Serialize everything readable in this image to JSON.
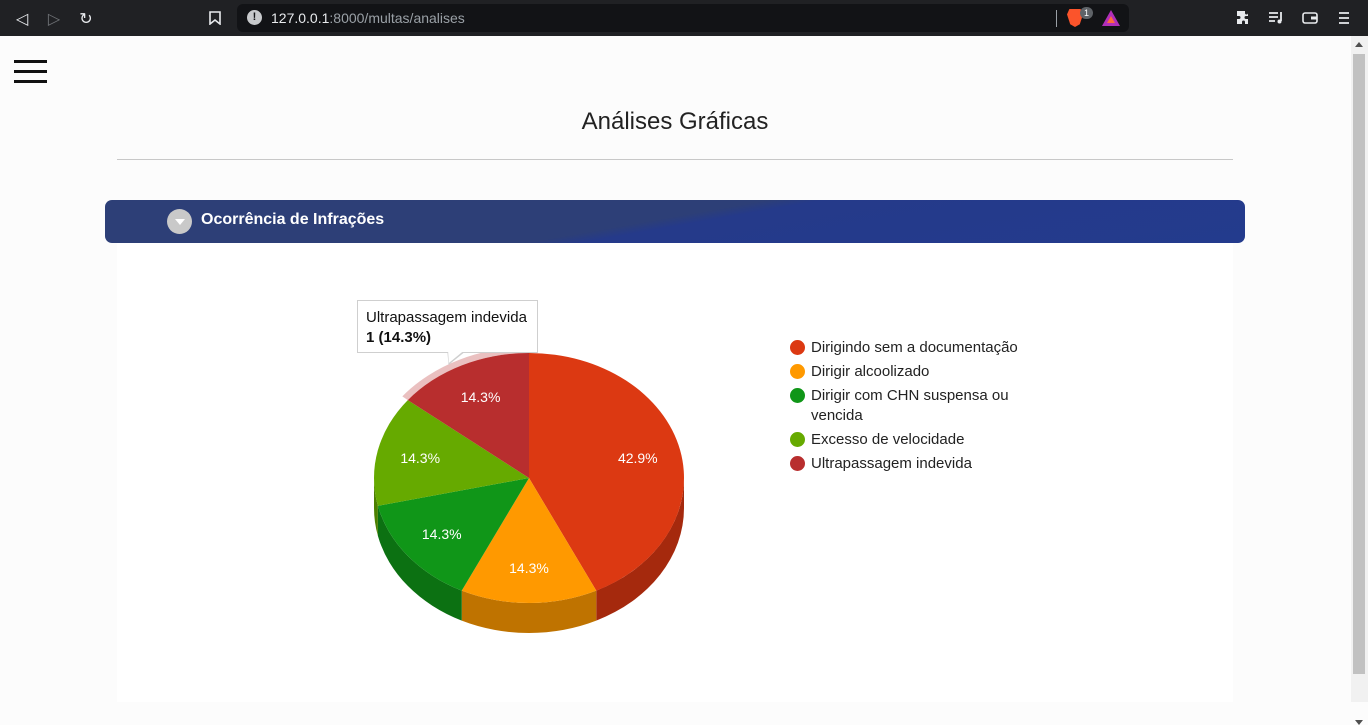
{
  "browser": {
    "url_host": "127.0.0.1",
    "url_rest": ":8000/multas/analises",
    "shields_count": "1"
  },
  "page": {
    "title": "Análises Gráficas"
  },
  "panel": {
    "title": "Ocorrência de Infrações"
  },
  "tooltip": {
    "label": "Ultrapassagem indevida",
    "value": "1 (14.3%)"
  },
  "colors": {
    "header": "#2d3f77",
    "dirigindo_sem_doc": "#dc3912",
    "dirigir_alcoolizado": "#ff9900",
    "dirigir_chn": "#109618",
    "excesso_velocidade": "#66aa00",
    "ultrapassagem": "#b82e2e"
  },
  "chart_data": {
    "type": "pie",
    "is3D": true,
    "title": "",
    "legend_position": "right",
    "slices": [
      {
        "label": "Dirigindo sem a documentação",
        "value": 3,
        "percent_label": "42.9%",
        "color": "#dc3912",
        "side_color": "#a5290d"
      },
      {
        "label": "Dirigir alcoolizado",
        "value": 1,
        "percent_label": "14.3%",
        "color": "#ff9900",
        "side_color": "#bf7300"
      },
      {
        "label": "Dirigir com CHN suspensa ou vencida",
        "value": 1,
        "percent_label": "14.3%",
        "color": "#109618",
        "side_color": "#0c7112"
      },
      {
        "label": "Excesso de velocidade",
        "value": 1,
        "percent_label": "14.3%",
        "color": "#66aa00",
        "side_color": "#4c8000"
      },
      {
        "label": "Ultrapassagem indevida",
        "value": 1,
        "percent_label": "14.3%",
        "color": "#b82e2e",
        "side_color": "#8a2222"
      }
    ],
    "highlighted_slice": "Ultrapassagem indevida"
  }
}
